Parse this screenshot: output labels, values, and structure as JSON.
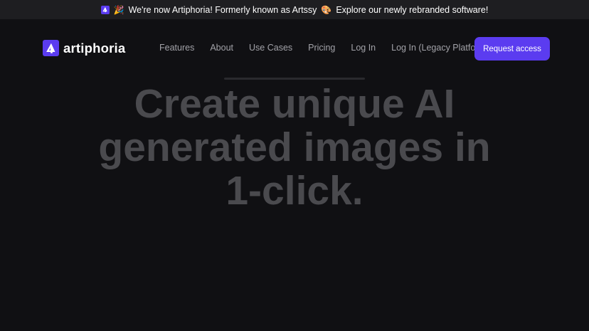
{
  "announcement": {
    "party_emoji": "🎉",
    "message_part1": "We're now Artiphoria! Formerly known as Artssy",
    "palette_emoji": "🎨",
    "message_part2": "Explore our newly rebranded software!"
  },
  "brand": {
    "name": "artiphoria",
    "color": "#5b3cf0"
  },
  "nav": {
    "links": [
      {
        "label": "Features"
      },
      {
        "label": "About"
      },
      {
        "label": "Use Cases"
      },
      {
        "label": "Pricing"
      },
      {
        "label": "Log In"
      },
      {
        "label": "Log In (Legacy Platform)"
      }
    ],
    "cta_label": "Request access"
  },
  "hero": {
    "headline": "Create unique AI generated images in 1-click."
  }
}
